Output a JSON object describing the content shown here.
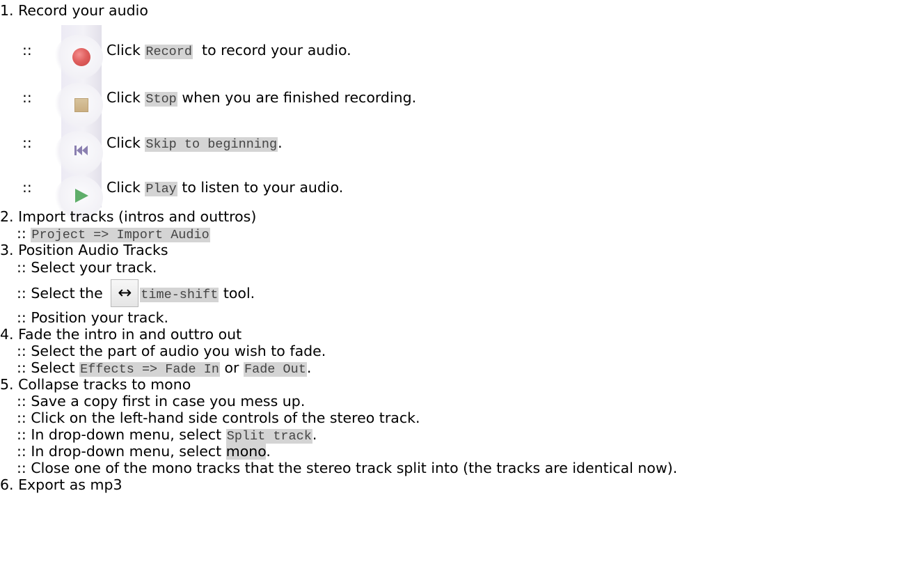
{
  "steps": [
    {
      "num": "1.",
      "title": "Record your audio"
    },
    {
      "num": "2.",
      "title": "Import tracks (intros and outtros)"
    },
    {
      "num": "3.",
      "title": "Position Audio Tracks"
    },
    {
      "num": "4.",
      "title": "Fade the intro in and outtro out"
    },
    {
      "num": "5.",
      "title": "Collapse tracks to mono"
    },
    {
      "num": "6.",
      "title": "Export as mp3"
    }
  ],
  "bullet": "::",
  "record": {
    "items": [
      {
        "pre": "Click ",
        "code": "Record",
        "post": "  to record your audio."
      },
      {
        "pre": "Click ",
        "code": "Stop",
        "post": " when you are finished recording."
      },
      {
        "pre": "Click ",
        "code": "Skip to beginning",
        "post": "."
      },
      {
        "pre": "Click ",
        "code": "Play",
        "post": " to listen to your audio."
      }
    ],
    "icons": [
      "record-icon",
      "stop-icon",
      "skip-to-beginning-icon",
      "play-icon"
    ],
    "colors": {
      "record": "#e0605f",
      "stop": "#c9ad80",
      "skip": "#8a7fb0",
      "play": "#5fae6a"
    }
  },
  "import": {
    "code": "Project => Import Audio"
  },
  "position": {
    "line1": "Select your track.",
    "line2_pre": "Select the ",
    "tool_glyph": "↔",
    "line2_code": "time-shift",
    "line2_post": " tool.",
    "line3": "Position your track."
  },
  "fade": {
    "line1": "Select the part of audio you wish to fade.",
    "line2_pre": "Select ",
    "code1": "Effects => Fade In",
    "mid": " or ",
    "code2": "Fade Out",
    "post": "."
  },
  "collapse": {
    "line1": "Save a copy first in case you mess up.",
    "line2": "Click on the left-hand side controls of the stereo track.",
    "line3_pre": "In drop-down menu, select ",
    "line3_code": "Split track",
    "line3_post": ".",
    "line4_pre": "In drop-down menu, select ",
    "line4_hl": "mono",
    "line4_post": ".",
    "line5": "Close one of the mono tracks that the stereo track split into (the tracks are identical now)."
  }
}
